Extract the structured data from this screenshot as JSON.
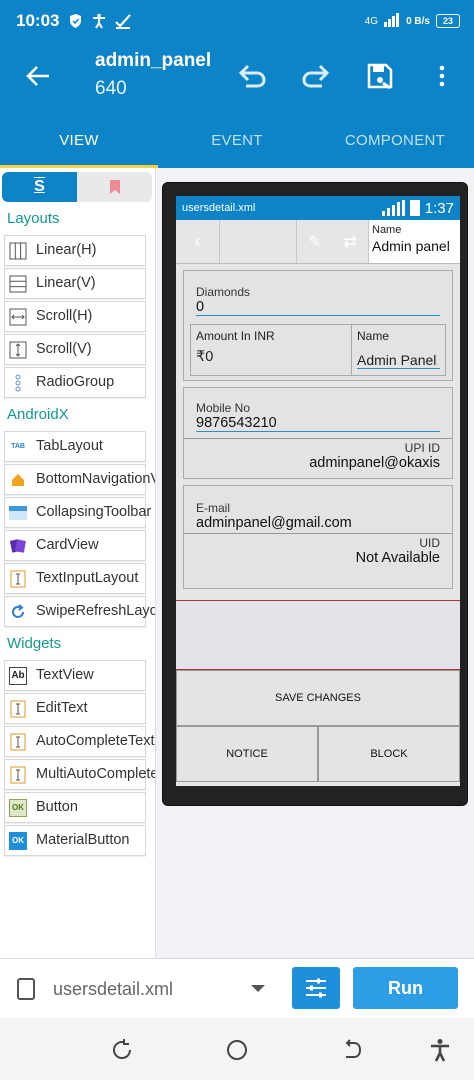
{
  "status_bar": {
    "time": "10:03",
    "network": "4G",
    "speed": "0 B/s",
    "battery": "23"
  },
  "app_bar": {
    "title": "admin_panel",
    "subtitle": "640"
  },
  "tabs": [
    {
      "label": "VIEW",
      "active": true
    },
    {
      "label": "EVENT"
    },
    {
      "label": "COMPONENT"
    }
  ],
  "palette": {
    "toggle_symbol": "S",
    "sections": [
      {
        "title": "Layouts",
        "items": [
          "Linear(H)",
          "Linear(V)",
          "Scroll(H)",
          "Scroll(V)",
          "RadioGroup"
        ]
      },
      {
        "title": "AndroidX",
        "items": [
          "TabLayout",
          "BottomNavigationView",
          "CollapsingToolbar",
          "CardView",
          "TextInputLayout",
          "SwipeRefreshLayout"
        ]
      },
      {
        "title": "Widgets",
        "items": [
          "TextView",
          "EditText",
          "AutoCompleteTextView",
          "MultiAutoCompleteTextView",
          "Button",
          "MaterialButton"
        ]
      }
    ]
  },
  "preview": {
    "file_label": "usersdetail.xml",
    "clock": "1:37",
    "top_name_label": "Name",
    "top_name_value": "Admin panel",
    "diamonds_label": "Diamonds",
    "diamonds_value": "0",
    "amount_label": "Amount In INR",
    "amount_value": "₹0",
    "name_label": "Name",
    "name_value": "Admin Panel",
    "mobile_label": "Mobile No",
    "mobile_value": "9876543210",
    "upi_label": "UPI ID",
    "upi_value": "adminpanel@okaxis",
    "email_label": "E-mail",
    "email_value": "adminpanel@gmail.com",
    "uid_label": "UID",
    "uid_value": "Not Available",
    "save_button": "SAVE CHANGES",
    "notice_button": "NOTICE",
    "block_button": "BLOCK"
  },
  "bottom_bar": {
    "filename": "usersdetail.xml",
    "run_label": "Run"
  },
  "colors": {
    "primary": "#0e84c8",
    "accent": "#f4d23c",
    "section": "#129a92"
  }
}
